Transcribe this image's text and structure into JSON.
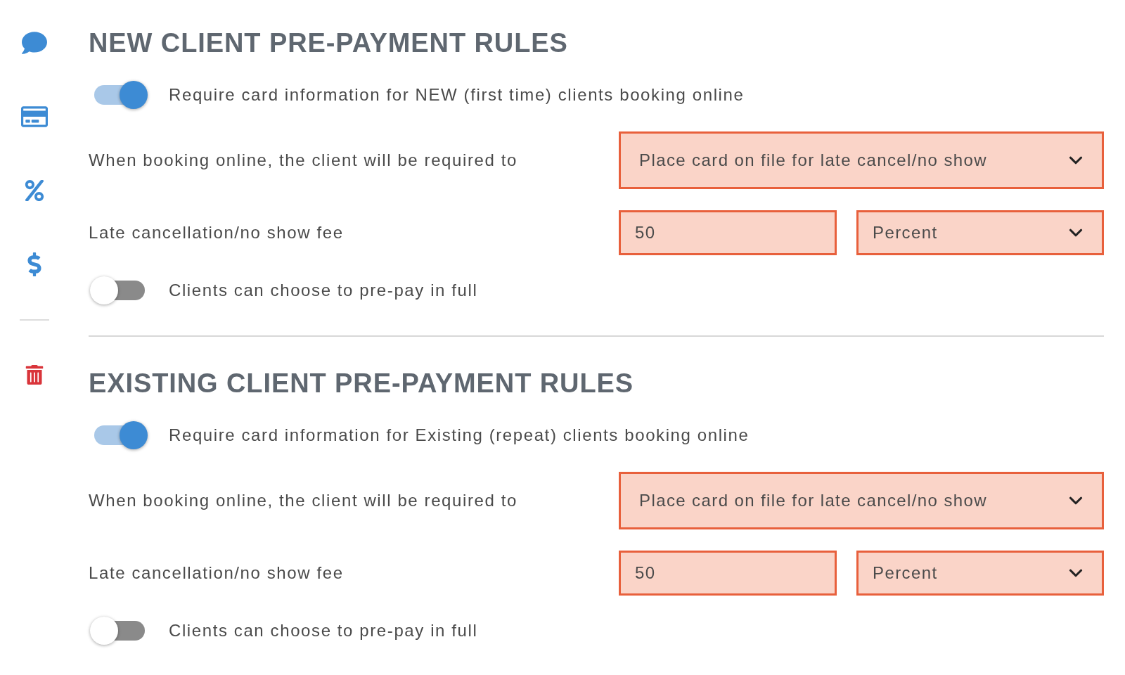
{
  "sidebar": {
    "items": [
      {
        "kind": "chat"
      },
      {
        "kind": "card"
      },
      {
        "kind": "percent"
      },
      {
        "kind": "dollar"
      },
      {
        "kind": "divider"
      },
      {
        "kind": "trash"
      }
    ]
  },
  "sections": [
    {
      "title": "NEW CLIENT PRE-PAYMENT RULES",
      "require_toggle": {
        "on": true,
        "label": "Require card information for NEW (first time) clients booking online"
      },
      "required_to": {
        "label": "When booking online, the client will be required to",
        "value": "Place card on file for late cancel/no show",
        "highlighted": true
      },
      "fee": {
        "label": "Late cancellation/no show fee",
        "amount": "50",
        "amount_highlighted": true,
        "unit": "Percent",
        "unit_highlighted": true
      },
      "prepay_toggle": {
        "on": false,
        "label": "Clients can choose to pre-pay in full"
      }
    },
    {
      "title": "EXISTING CLIENT PRE-PAYMENT RULES",
      "require_toggle": {
        "on": true,
        "label": "Require card information for Existing (repeat) clients booking online"
      },
      "required_to": {
        "label": "When booking online, the client will be required to",
        "value": "Place card on file for late cancel/no show",
        "highlighted": true
      },
      "fee": {
        "label": "Late cancellation/no show fee",
        "amount": "50",
        "amount_highlighted": true,
        "unit": "Percent",
        "unit_highlighted": true
      },
      "prepay_toggle": {
        "on": false,
        "label": "Clients can choose to pre-pay in full"
      }
    }
  ]
}
